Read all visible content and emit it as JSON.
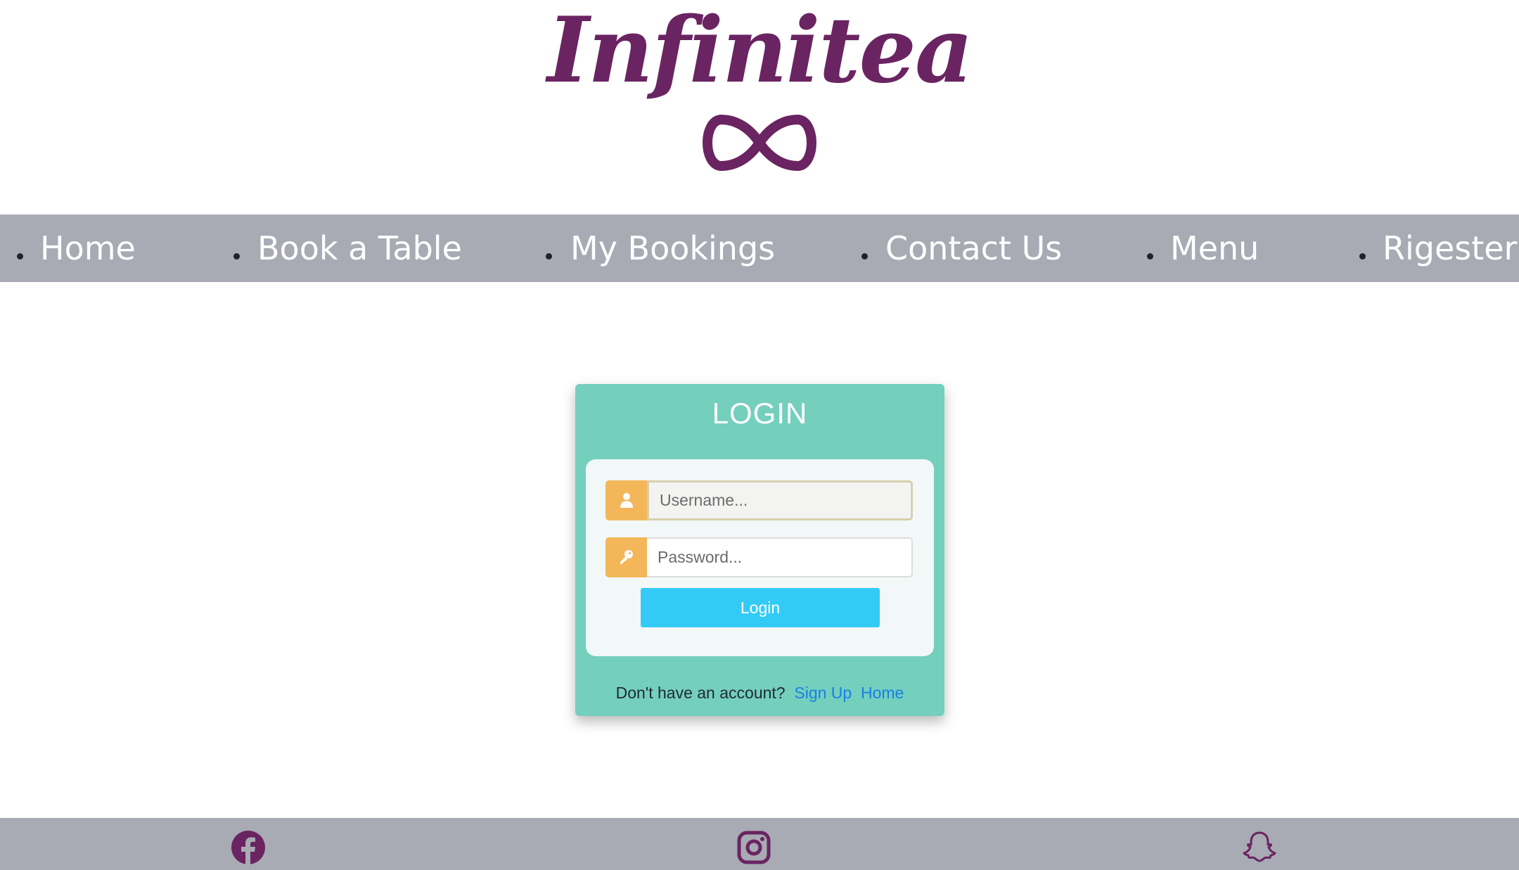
{
  "brand": {
    "name": "Infinitea",
    "color": "#6a2461"
  },
  "nav": {
    "items": [
      {
        "label": "Home"
      },
      {
        "label": "Book a Table"
      },
      {
        "label": "My Bookings"
      },
      {
        "label": "Contact Us"
      },
      {
        "label": "Menu"
      },
      {
        "label": "Rigester"
      }
    ]
  },
  "login": {
    "title": "LOGIN",
    "username_placeholder": "Username...",
    "password_placeholder": "Password...",
    "button_label": "Login",
    "no_account_text": "Don't have an account?",
    "signup_link": "Sign Up",
    "home_link": "Home"
  },
  "icons": {
    "username": "user-icon",
    "password": "key-icon",
    "social": [
      "facebook-icon",
      "instagram-icon",
      "snapchat-icon"
    ]
  },
  "colors": {
    "navbar": "#a8abb4",
    "card": "#74cfbd",
    "addon": "#f3b75a",
    "button": "#33cbf6",
    "link": "#1a7fe6"
  }
}
